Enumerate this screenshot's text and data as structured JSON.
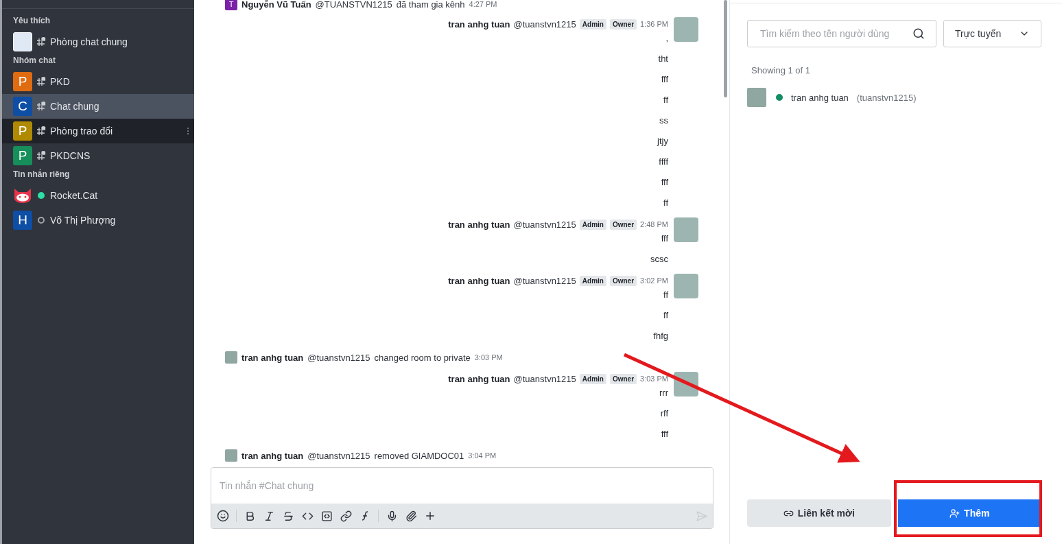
{
  "sidebar": {
    "sections": [
      {
        "title": "Yêu thích",
        "items": [
          {
            "name": "Phòng chat chung",
            "avatar": {
              "kind": "image"
            },
            "kind": "channel",
            "selected": false,
            "hovered": false
          }
        ]
      },
      {
        "title": "Nhóm chat",
        "items": [
          {
            "name": "PKD",
            "avatar": {
              "kind": "letter",
              "letter": "P",
              "color": "#e06c12"
            },
            "kind": "channel",
            "selected": false,
            "hovered": false
          },
          {
            "name": "Chat chung",
            "avatar": {
              "kind": "letter",
              "letter": "C",
              "color": "#0e4ea5"
            },
            "kind": "channel",
            "selected": true,
            "hovered": false
          },
          {
            "name": "Phòng trao đổi",
            "avatar": {
              "kind": "letter",
              "letter": "P",
              "color": "#b08a00"
            },
            "kind": "channel",
            "selected": false,
            "hovered": true
          },
          {
            "name": "PKDCNS",
            "avatar": {
              "kind": "letter",
              "letter": "P",
              "color": "#168f5a"
            },
            "kind": "channel",
            "selected": false,
            "hovered": false
          }
        ]
      },
      {
        "title": "Tin nhắn riêng",
        "items": [
          {
            "name": "Rocket.Cat",
            "avatar": {
              "kind": "cat"
            },
            "kind": "direct",
            "online": true,
            "selected": false,
            "hovered": false
          },
          {
            "name": "Võ Thị Phượng",
            "avatar": {
              "kind": "letter",
              "letter": "H",
              "color": "#0e4ea5"
            },
            "kind": "direct",
            "online": false,
            "selected": false,
            "hovered": false
          }
        ]
      }
    ]
  },
  "messages": [
    {
      "kind": "system",
      "author": "Nguyễn Vũ Tuấn",
      "username": "@TUANSTVN1215",
      "action": "đã tham gia kênh",
      "time": "4:27 PM",
      "avatar_letter": "T"
    },
    {
      "kind": "message",
      "author": "tran anhg tuan",
      "username": "@tuanstvn1215",
      "badges": [
        "Admin",
        "Owner"
      ],
      "time": "1:36 PM",
      "lines": [
        ",",
        "tht",
        "fff",
        "ff",
        "ss",
        "jtjy",
        "ffff",
        "fff",
        "ff"
      ]
    },
    {
      "kind": "message",
      "author": "tran anhg tuan",
      "username": "@tuanstvn1215",
      "badges": [
        "Admin",
        "Owner"
      ],
      "time": "2:48 PM",
      "lines": [
        "fff",
        "scsc"
      ]
    },
    {
      "kind": "message",
      "author": "tran anhg tuan",
      "username": "@tuanstvn1215",
      "badges": [
        "Admin",
        "Owner"
      ],
      "time": "3:02 PM",
      "lines": [
        "ff",
        "ff",
        "fhfg"
      ]
    },
    {
      "kind": "system",
      "author": "tran anhg tuan",
      "username": "@tuanstvn1215",
      "action": "changed room to private",
      "time": "3:03 PM"
    },
    {
      "kind": "message",
      "author": "tran anhg tuan",
      "username": "@tuanstvn1215",
      "badges": [
        "Admin",
        "Owner"
      ],
      "time": "3:03 PM",
      "lines": [
        "rrr",
        "rff",
        "fff"
      ]
    },
    {
      "kind": "system",
      "author": "tran anhg tuan",
      "username": "@tuanstvn1215",
      "action": "removed GIAMDOC01",
      "time": "3:04 PM"
    }
  ],
  "composer": {
    "placeholder": "Tin nhắn #Chat chung"
  },
  "members_panel": {
    "search": {
      "placeholder": "Tìm kiếm theo tên người dùng"
    },
    "filter": "Trực tuyến",
    "showing": "Showing 1 of 1",
    "members": [
      {
        "name": "tran anhg tuan",
        "username": "(tuanstvn1215)",
        "online": true
      }
    ],
    "buttons": [
      {
        "label": "Liên kết mời",
        "kind": "secondary"
      },
      {
        "label": "Thêm",
        "kind": "primary"
      }
    ]
  }
}
